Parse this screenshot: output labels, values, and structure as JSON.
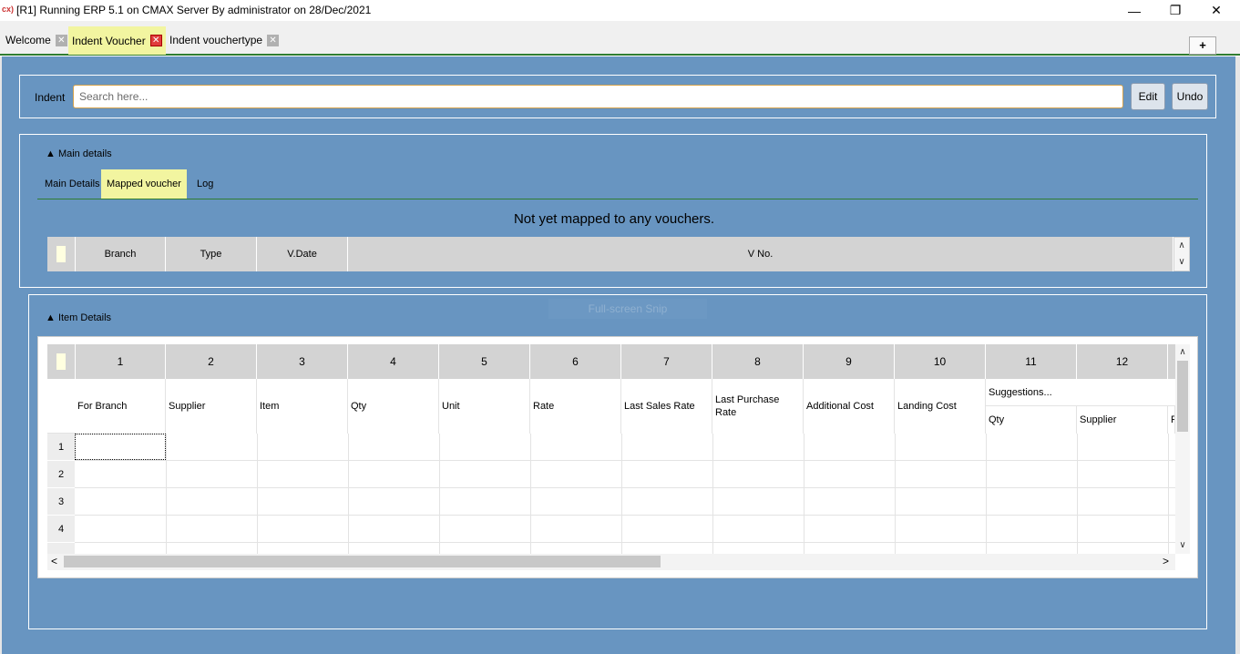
{
  "window": {
    "title": "[R1] Running ERP 5.1 on CMAX Server By administrator on 28/Dec/2021",
    "icon_text": "cx)",
    "controls": {
      "minimize": "—",
      "maximize": "❐",
      "close": "✕"
    }
  },
  "tabs": [
    {
      "label": "Welcome",
      "active": false
    },
    {
      "label": "Indent Voucher",
      "active": true
    },
    {
      "label": "Indent vouchertype",
      "active": false
    }
  ],
  "tab_close_glyph": "✕",
  "new_tab_label": "+",
  "indent": {
    "label": "Indent",
    "search_placeholder": "Search here...",
    "edit_label": "Edit",
    "undo_label": "Undo"
  },
  "main_details": {
    "toggle_label": "▲ Main details",
    "subtabs": [
      {
        "label": "Main Details",
        "active": false
      },
      {
        "label": "Mapped voucher",
        "active": true
      },
      {
        "label": "Log",
        "active": false
      }
    ],
    "empty_message": "Not yet mapped to any vouchers.",
    "mapped_columns": [
      "Branch",
      "Type",
      "V.Date",
      "V No."
    ]
  },
  "item_details": {
    "toggle_label": "▲ Item Details",
    "snip_overlay": "Full-screen Snip",
    "column_numbers": [
      "1",
      "2",
      "3",
      "4",
      "5",
      "6",
      "7",
      "8",
      "9",
      "10",
      "11",
      "12"
    ],
    "column_headers": [
      "For Branch",
      "Supplier",
      "Item",
      "Qty",
      "Unit",
      "Rate",
      "Last Sales Rate",
      "Last Purchase Rate",
      "Additional Cost",
      "Landing Cost"
    ],
    "suggestions_label": "Suggestions...",
    "suggestions_sub": [
      "Qty",
      "Supplier",
      "F"
    ],
    "row_numbers": [
      "1",
      "2",
      "3",
      "4"
    ]
  },
  "scroll": {
    "up": "∧",
    "down": "∨",
    "left": "<",
    "right": ">"
  }
}
